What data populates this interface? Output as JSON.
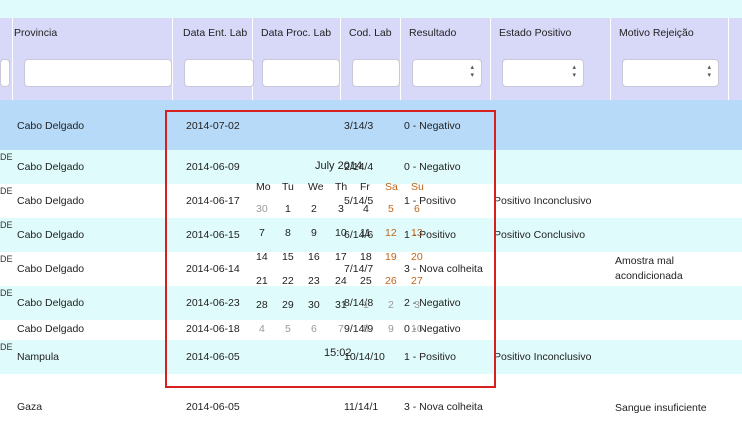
{
  "columns": [
    "Provincia",
    "Data Ent. Lab",
    "Data Proc. Lab",
    "Cod. Lab",
    "Resultado",
    "Estado Positivo",
    "Motivo Rejeição"
  ],
  "rows": [
    {
      "prefix": "",
      "provincia": "Cabo Delgado",
      "data_ent": "2014-07-02",
      "cod": "3/14/3",
      "resultado": "0 - Negativo",
      "estado": "",
      "motivo": ""
    },
    {
      "prefix": "DE",
      "provincia": "Cabo Delgado",
      "data_ent": "2014-06-09",
      "cod": "2/14/4",
      "resultado": "0 - Negativo",
      "estado": "",
      "motivo": ""
    },
    {
      "prefix": "DE",
      "provincia": "Cabo Delgado",
      "data_ent": "2014-06-17",
      "cod": "5/14/5",
      "resultado": "1 - Positivo",
      "estado": "Positivo Inconclusivo",
      "motivo": ""
    },
    {
      "prefix": "DE",
      "provincia": "Cabo Delgado",
      "data_ent": "2014-06-15",
      "cod": "6/14/6",
      "resultado": "1 - Positivo",
      "estado": "Positivo Conclusivo",
      "motivo": ""
    },
    {
      "prefix": "DE",
      "provincia": "Cabo Delgado",
      "data_ent": "2014-06-14",
      "cod": "7/14/7",
      "resultado": "3 - Nova colheita",
      "estado": "",
      "motivo": "Amostra mal\nacondicionada"
    },
    {
      "prefix": "DE",
      "provincia": "Cabo Delgado",
      "data_ent": "2014-06-23",
      "cod": "8/14/8",
      "resultado": "2 - Negativo",
      "estado": "",
      "motivo": ""
    },
    {
      "prefix": "",
      "provincia": "Cabo Delgado",
      "data_ent": "2014-06-18",
      "cod": "9/14/9",
      "resultado": "0 - Negativo",
      "estado": "",
      "motivo": ""
    },
    {
      "prefix": "DE",
      "provincia": "Nampula",
      "data_ent": "2014-06-05",
      "cod": "10/14/10",
      "resultado": "1 - Positivo",
      "estado": "Positivo Inconclusivo",
      "motivo": ""
    },
    {
      "prefix": "",
      "provincia": "Gaza",
      "data_ent": "2014-06-05",
      "cod": "11/14/1",
      "resultado": "3 - Nova colheita",
      "estado": "",
      "motivo": "Sangue insuficiente"
    }
  ],
  "datepicker": {
    "month_title": "July 2014",
    "weekdays": [
      "Mo",
      "Tu",
      "We",
      "Th",
      "Fr",
      "Sa",
      "Su"
    ],
    "weeks": [
      [
        "30",
        "1",
        "2",
        "3",
        "4",
        "5",
        "6"
      ],
      [
        "7",
        "8",
        "9",
        "10",
        "11",
        "12",
        "13"
      ],
      [
        "14",
        "15",
        "16",
        "17",
        "18",
        "19",
        "20"
      ],
      [
        "21",
        "22",
        "23",
        "24",
        "25",
        "26",
        "27"
      ],
      [
        "28",
        "29",
        "30",
        "31",
        "1",
        "2",
        "3"
      ],
      [
        "4",
        "5",
        "6",
        "7",
        "8",
        "9",
        "10"
      ]
    ],
    "time": "15:02"
  },
  "colors": {
    "header_bg": "#d8d8f8",
    "row_alt": "#e0fbfb",
    "selected_row": "#b7daf8",
    "picker_border": "#d61f1f",
    "weekend": "#c0651a"
  }
}
